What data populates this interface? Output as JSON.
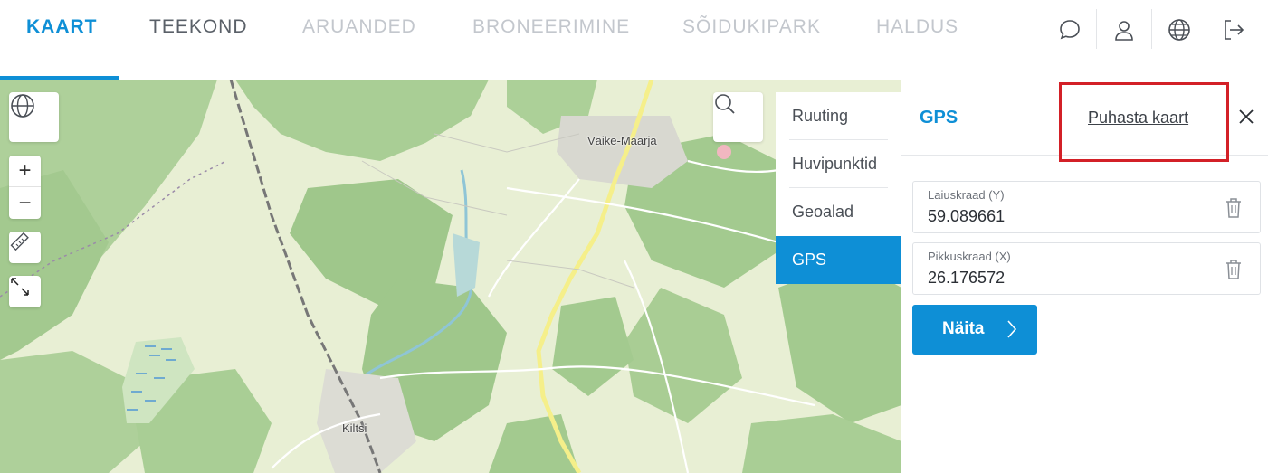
{
  "nav": {
    "tabs": [
      {
        "label": "KAART"
      },
      {
        "label": "TEEKOND"
      },
      {
        "label": "ARUANDED"
      },
      {
        "label": "BRONEERIMINE"
      },
      {
        "label": "SÕIDUKIPARK"
      },
      {
        "label": "HALDUS"
      }
    ],
    "icons": [
      "chat-icon",
      "user-icon",
      "globe-icon",
      "logout-icon"
    ]
  },
  "map": {
    "labels": {
      "town1": "Väike-Maarja",
      "town2": "Kiltsi"
    },
    "controls": {
      "zoom_in": "+",
      "zoom_out": "−"
    }
  },
  "side_menu": {
    "items": [
      {
        "label": "Ruuting"
      },
      {
        "label": "Huvipunktid"
      },
      {
        "label": "Geoalad"
      },
      {
        "label": "GPS"
      }
    ],
    "active": "GPS"
  },
  "panel": {
    "title": "GPS",
    "clear_link": "Puhasta kaart",
    "fields": [
      {
        "label": "Laiuskraad (Y)",
        "value": "59.089661"
      },
      {
        "label": "Pikkuskraad (X)",
        "value": "26.176572"
      }
    ],
    "show_button": "Näita"
  },
  "colors": {
    "accent": "#0e8fd6",
    "highlight": "#d32027",
    "inactive_tab": "#c3c7cd"
  }
}
